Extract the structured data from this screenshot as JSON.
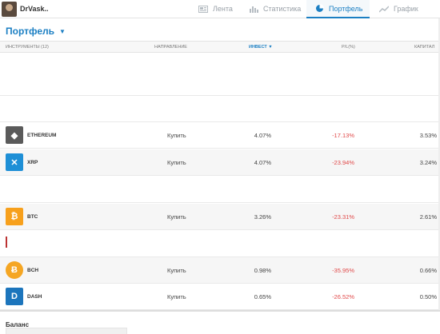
{
  "user": {
    "name": "DrVask.."
  },
  "nav": [
    {
      "label": "Лента",
      "icon": "news-icon"
    },
    {
      "label": "Статистика",
      "icon": "stats-icon"
    },
    {
      "label": "Портфель",
      "icon": "pie-chart-icon",
      "active": true
    },
    {
      "label": "График",
      "icon": "line-chart-icon"
    }
  ],
  "portfolio": {
    "title": "Портфель"
  },
  "table": {
    "headers": {
      "instruments": "ИНСТРУМЕНТЫ (12)",
      "direction": "НАПРАВЛЕНИЕ",
      "invest": "ИНВЕСТ",
      "pl": "P/L(%)",
      "capital": "КАПИТАЛ"
    },
    "rows": [
      {
        "name": "ETHEREUM",
        "direction": "Купить",
        "invest": "4.07%",
        "pl": "-17.13%",
        "capital": "3.53%",
        "color": "#5a5a5a",
        "glyph": "◆"
      },
      {
        "name": "XRP",
        "direction": "Купить",
        "invest": "4.07%",
        "pl": "-23.94%",
        "capital": "3.24%",
        "color": "#1e8fd6",
        "glyph": "✕"
      },
      {
        "name": "BTC",
        "direction": "Купить",
        "invest": "3.26%",
        "pl": "-23.31%",
        "capital": "2.61%",
        "color": "#f7a01c",
        "glyph": "₿"
      },
      {
        "name": "BCH",
        "direction": "Купить",
        "invest": "0.98%",
        "pl": "-35.95%",
        "capital": "0.66%",
        "color": "#f5a623",
        "glyph": "Ƀ"
      },
      {
        "name": "DASH",
        "direction": "Купить",
        "invest": "0.65%",
        "pl": "-26.52%",
        "capital": "0.50%",
        "color": "#1c75bc",
        "glyph": "D"
      }
    ]
  },
  "footer": {
    "balance_label": "Баланс"
  }
}
